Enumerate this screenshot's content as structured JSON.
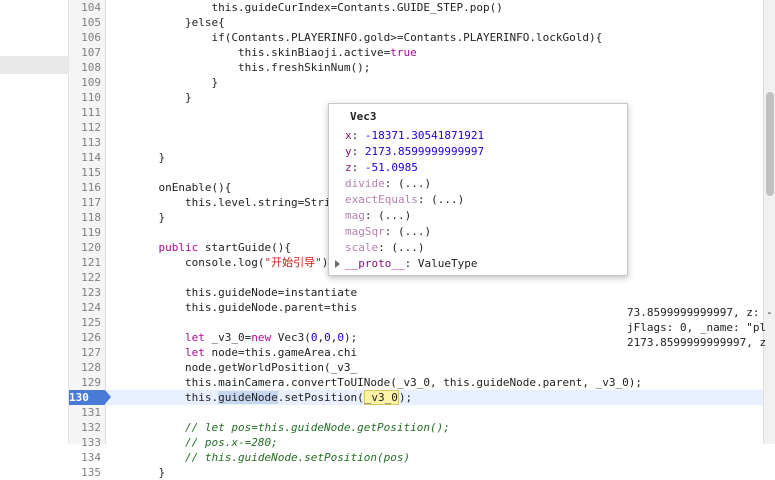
{
  "lines": [
    {
      "n": "104",
      "segs": [
        {
          "t": "            this.guideCurIndex=Contants.GUIDE_STEP.pop()"
        }
      ]
    },
    {
      "n": "105",
      "segs": [
        {
          "t": "        }else{"
        }
      ]
    },
    {
      "n": "106",
      "segs": [
        {
          "t": "            if(Contants.PLAYERINFO.gold>=Contants.PLAYERINFO.lockGold){"
        }
      ]
    },
    {
      "n": "107",
      "segs": [
        {
          "t": "                this.skinBiaoji.active="
        },
        {
          "t": "true",
          "c": "kw"
        }
      ]
    },
    {
      "n": "108",
      "segs": [
        {
          "t": "                this.freshSkinNum();"
        }
      ]
    },
    {
      "n": "109",
      "segs": [
        {
          "t": "            }"
        }
      ]
    },
    {
      "n": "110",
      "segs": [
        {
          "t": "        }"
        }
      ]
    },
    {
      "n": "111",
      "segs": [
        {
          "t": ""
        }
      ]
    },
    {
      "n": "112",
      "segs": [
        {
          "t": ""
        }
      ]
    },
    {
      "n": "113",
      "segs": [
        {
          "t": ""
        }
      ]
    },
    {
      "n": "114",
      "segs": [
        {
          "t": "    }"
        }
      ]
    },
    {
      "n": "115",
      "segs": [
        {
          "t": ""
        }
      ]
    },
    {
      "n": "116",
      "segs": [
        {
          "t": "    onEnable(){"
        }
      ]
    },
    {
      "n": "117",
      "segs": [
        {
          "t": "        this.level.string=String(C"
        }
      ]
    },
    {
      "n": "118",
      "segs": [
        {
          "t": "    }"
        }
      ]
    },
    {
      "n": "119",
      "segs": [
        {
          "t": ""
        }
      ]
    },
    {
      "n": "120",
      "segs": [
        {
          "t": "    "
        },
        {
          "t": "public",
          "c": "kw"
        },
        {
          "t": " startGuide(){"
        }
      ]
    },
    {
      "n": "121",
      "segs": [
        {
          "t": "        console.log("
        },
        {
          "t": "\"开始引导\"",
          "c": "str"
        },
        {
          "t": ")"
        }
      ]
    },
    {
      "n": "122",
      "segs": [
        {
          "t": ""
        }
      ]
    },
    {
      "n": "123",
      "segs": [
        {
          "t": "        this.guideNode=instantiate"
        }
      ]
    },
    {
      "n": "124",
      "segs": [
        {
          "t": "        this.guideNode.parent=this"
        }
      ]
    },
    {
      "n": "125",
      "segs": [
        {
          "t": ""
        }
      ]
    },
    {
      "n": "126",
      "segs": [
        {
          "t": "        "
        },
        {
          "t": "let",
          "c": "kw"
        },
        {
          "t": " _v3_0="
        },
        {
          "t": "new",
          "c": "kw"
        },
        {
          "t": " Vec3("
        },
        {
          "t": "0",
          "c": "num"
        },
        {
          "t": ","
        },
        {
          "t": "0",
          "c": "num"
        },
        {
          "t": ","
        },
        {
          "t": "0",
          "c": "num"
        },
        {
          "t": ");"
        }
      ]
    },
    {
      "n": "127",
      "segs": [
        {
          "t": "        "
        },
        {
          "t": "let",
          "c": "kw"
        },
        {
          "t": " node=this.gameArea.chi"
        }
      ]
    },
    {
      "n": "128",
      "segs": [
        {
          "t": "        node.getWorldPosition(_v3_"
        }
      ]
    },
    {
      "n": "129",
      "segs": [
        {
          "t": "        this.mainCamera.convertToUINode(_v3_0, this.guideNode.parent, _v3_0);"
        }
      ]
    },
    {
      "n": "130",
      "active": true,
      "segs": [
        {
          "t": "        this."
        },
        {
          "t": "guideNode",
          "c": "sel"
        },
        {
          "t": ".setPosition("
        },
        {
          "t": "_v3_0",
          "c": "val"
        },
        {
          "t": ");"
        }
      ]
    },
    {
      "n": "131",
      "segs": [
        {
          "t": ""
        }
      ]
    },
    {
      "n": "132",
      "segs": [
        {
          "t": "        // let pos=this.guideNode.getPosition();",
          "c": "cmt"
        }
      ]
    },
    {
      "n": "133",
      "segs": [
        {
          "t": "        // pos.x-=280;",
          "c": "cmt"
        }
      ]
    },
    {
      "n": "134",
      "segs": [
        {
          "t": "        // this.guideNode.setPosition(pos)",
          "c": "cmt"
        }
      ]
    },
    {
      "n": "135",
      "segs": [
        {
          "t": "    }"
        }
      ]
    }
  ],
  "overflow": {
    "l126": "73.8599999999997, z: -",
    "l127": "jFlags: 0, _name: \"pl",
    "l128": "2173.8599999999997, z"
  },
  "popover": {
    "title": "Vec3",
    "rows": [
      {
        "key": "x",
        "sep": ": ",
        "val": "-18371.30541871921",
        "type": "num"
      },
      {
        "key": "y",
        "sep": ": ",
        "val": "2173.8599999999997",
        "type": "num"
      },
      {
        "key": "z",
        "sep": ": ",
        "val": "-51.0985",
        "type": "num"
      },
      {
        "key": "divide",
        "sep": ": ",
        "val": "(...)",
        "type": "dim"
      },
      {
        "key": "exactEquals",
        "sep": ": ",
        "val": "(...)",
        "type": "dim"
      },
      {
        "key": "mag",
        "sep": ": ",
        "val": "(...)",
        "type": "dim"
      },
      {
        "key": "magSqr",
        "sep": ": ",
        "val": "(...)",
        "type": "dim"
      },
      {
        "key": "scale",
        "sep": ": ",
        "val": "(...)",
        "type": "dim"
      },
      {
        "key": "__proto__",
        "sep": ": ",
        "val": "ValueType",
        "type": "proto"
      }
    ]
  }
}
